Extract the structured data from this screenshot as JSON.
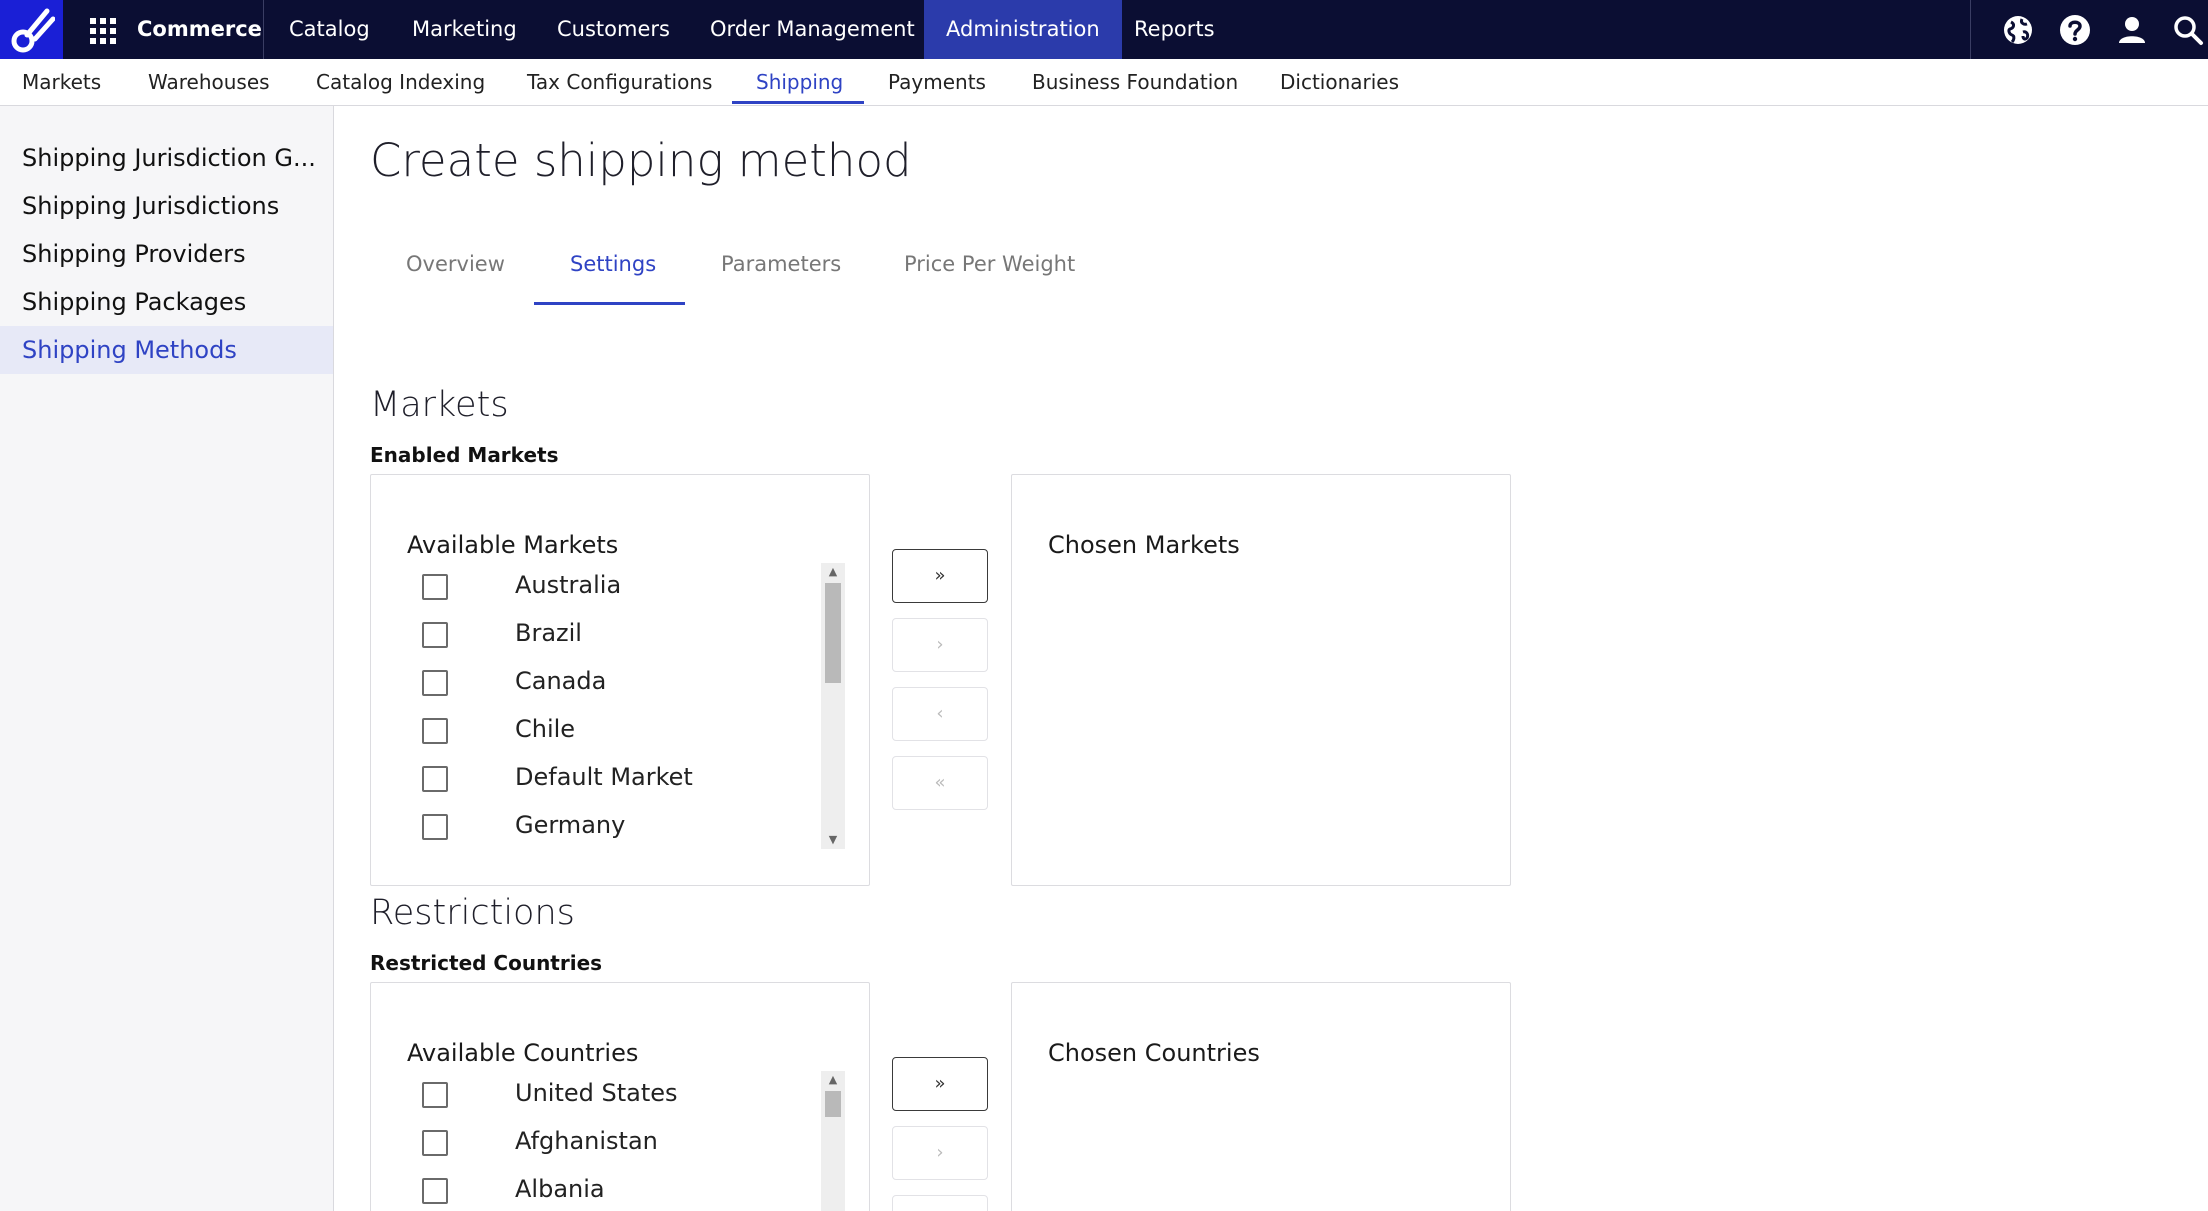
{
  "topbar": {
    "brand": "Commerce",
    "nav": [
      {
        "label": "Catalog"
      },
      {
        "label": "Marketing"
      },
      {
        "label": "Customers"
      },
      {
        "label": "Order Management"
      },
      {
        "label": "Administration",
        "active": true
      },
      {
        "label": "Reports"
      }
    ],
    "icons": [
      "globe-icon",
      "help-icon",
      "user-icon",
      "search-icon"
    ],
    "colors": {
      "background": "#0b0e33",
      "active": "#2b3bab",
      "logo": "#1a1fd6"
    }
  },
  "subnav": {
    "items": [
      {
        "label": "Markets"
      },
      {
        "label": "Warehouses"
      },
      {
        "label": "Catalog Indexing"
      },
      {
        "label": "Tax Configurations"
      },
      {
        "label": "Shipping",
        "active": true
      },
      {
        "label": "Payments"
      },
      {
        "label": "Business Foundation"
      },
      {
        "label": "Dictionaries"
      }
    ]
  },
  "sidebar": {
    "items": [
      {
        "label": "Shipping Jurisdiction G..."
      },
      {
        "label": "Shipping Jurisdictions"
      },
      {
        "label": "Shipping Providers"
      },
      {
        "label": "Shipping Packages"
      },
      {
        "label": "Shipping Methods",
        "active": true
      }
    ]
  },
  "page": {
    "title": "Create shipping method",
    "tabs": [
      {
        "label": "Overview"
      },
      {
        "label": "Settings",
        "active": true
      },
      {
        "label": "Parameters"
      },
      {
        "label": "Price Per Weight"
      }
    ]
  },
  "markets": {
    "section_title": "Markets",
    "subtitle": "Enabled Markets",
    "available_title": "Available Markets",
    "chosen_title": "Chosen Markets",
    "available": [
      "Australia",
      "Brazil",
      "Canada",
      "Chile",
      "Default Market",
      "Germany"
    ],
    "buttons": {
      "add_all": "»",
      "add": "›",
      "remove": "‹",
      "remove_all": "«"
    }
  },
  "restrictions": {
    "section_title": "Restrictions",
    "subtitle": "Restricted Countries",
    "available_title": "Available Countries",
    "chosen_title": "Chosen Countries",
    "available": [
      "United States",
      "Afghanistan",
      "Albania"
    ],
    "buttons": {
      "add_all": "»",
      "add": "›"
    }
  },
  "accent_color": "#2f43c4"
}
